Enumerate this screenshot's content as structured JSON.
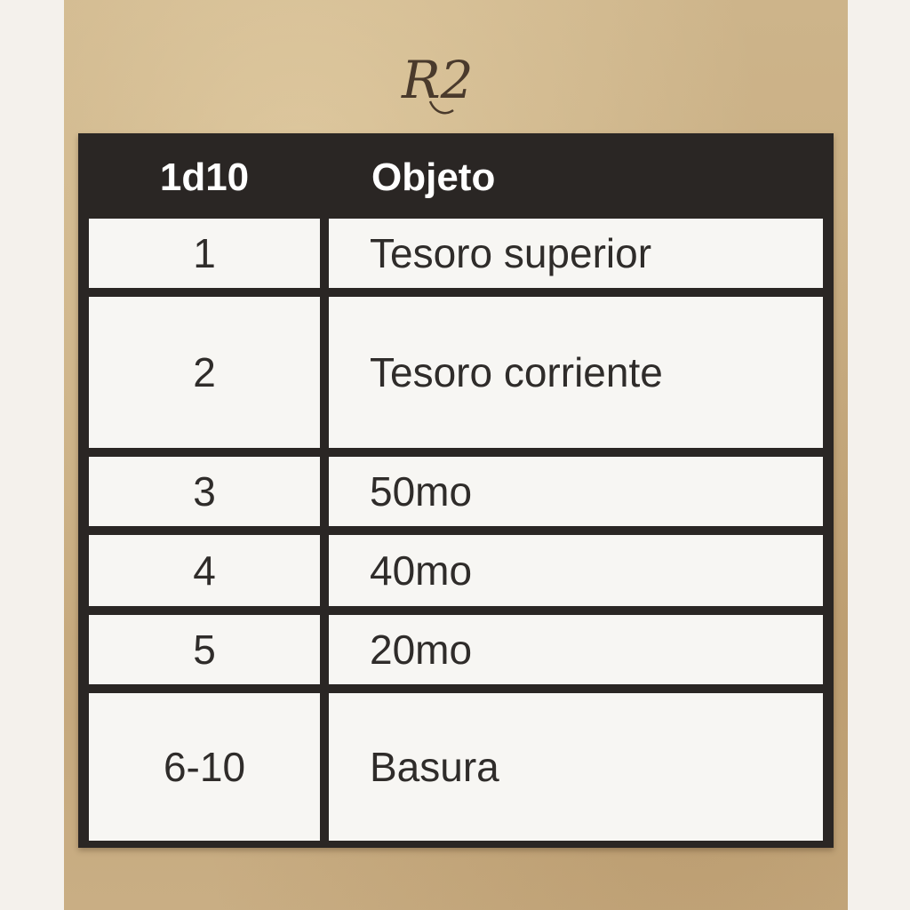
{
  "logo": {
    "text": "R2",
    "icon": "r2-monogram-logo"
  },
  "table": {
    "headers": [
      "1d10",
      "Objeto"
    ],
    "rows": [
      {
        "roll": "1",
        "item": "Tesoro superior"
      },
      {
        "roll": "2",
        "item": "Tesoro corriente"
      },
      {
        "roll": "3",
        "item": "50mo"
      },
      {
        "roll": "4",
        "item": "40mo"
      },
      {
        "roll": "5",
        "item": "20mo"
      },
      {
        "roll": "6-10",
        "item": "Basura"
      }
    ]
  },
  "colors": {
    "background": "#c9ae84",
    "header": "#2a2624",
    "cell": "#f7f6f3",
    "text": "#2f2c2a"
  }
}
